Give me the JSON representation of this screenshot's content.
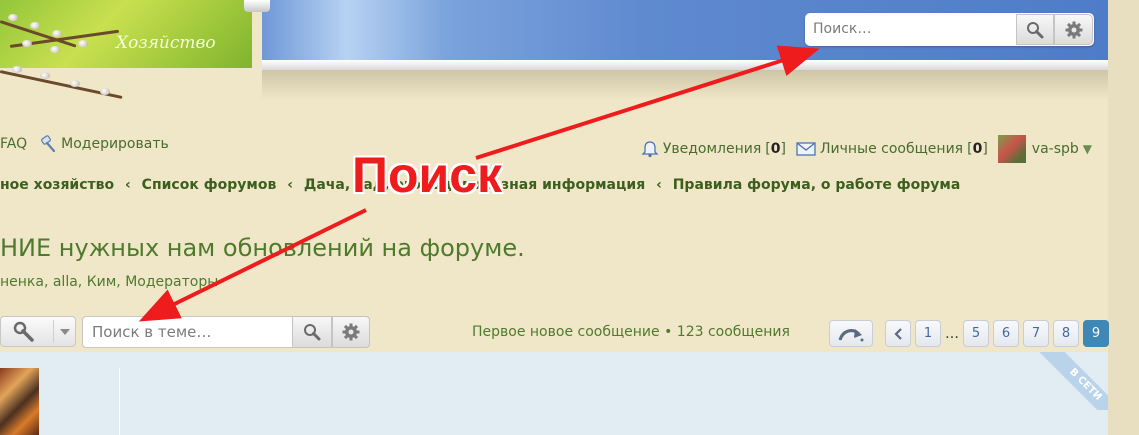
{
  "header": {
    "title": "Хозяйство",
    "search_placeholder": "Поиск…"
  },
  "nav": {
    "left": [
      {
        "label": "FAQ",
        "icon": "question-icon"
      },
      {
        "label": "Модерировать",
        "icon": "hammer-icon"
      }
    ],
    "notifications_label": "Уведомления",
    "notifications_count": "0",
    "messages_label": "Личные сообщения",
    "messages_count": "0",
    "username": "va-spb"
  },
  "breadcrumbs": [
    "ное хозяйство",
    "Список форумов",
    "Дача, сад, огород, полезная информация",
    "Правила форума, о работе форума"
  ],
  "topic": {
    "title": "НИЕ нужных нам обновлений на форуме.",
    "moderators": "ненка, alla, Ким, Модераторы"
  },
  "toolbar": {
    "search_placeholder": "Поиск в теме…",
    "stats": "Первое новое сообщение • 123 сообщения"
  },
  "pagination": {
    "pages": [
      "1",
      "5",
      "6",
      "7",
      "8",
      "9"
    ],
    "ellipsis": "…",
    "current": "9"
  },
  "post": {
    "online_badge": "В СЕТИ"
  },
  "annotation": {
    "label": "Поиск",
    "color": "#ee1c1c"
  },
  "colors": {
    "link_green": "#4a6c2f",
    "accent_blue": "#3f87b4"
  }
}
